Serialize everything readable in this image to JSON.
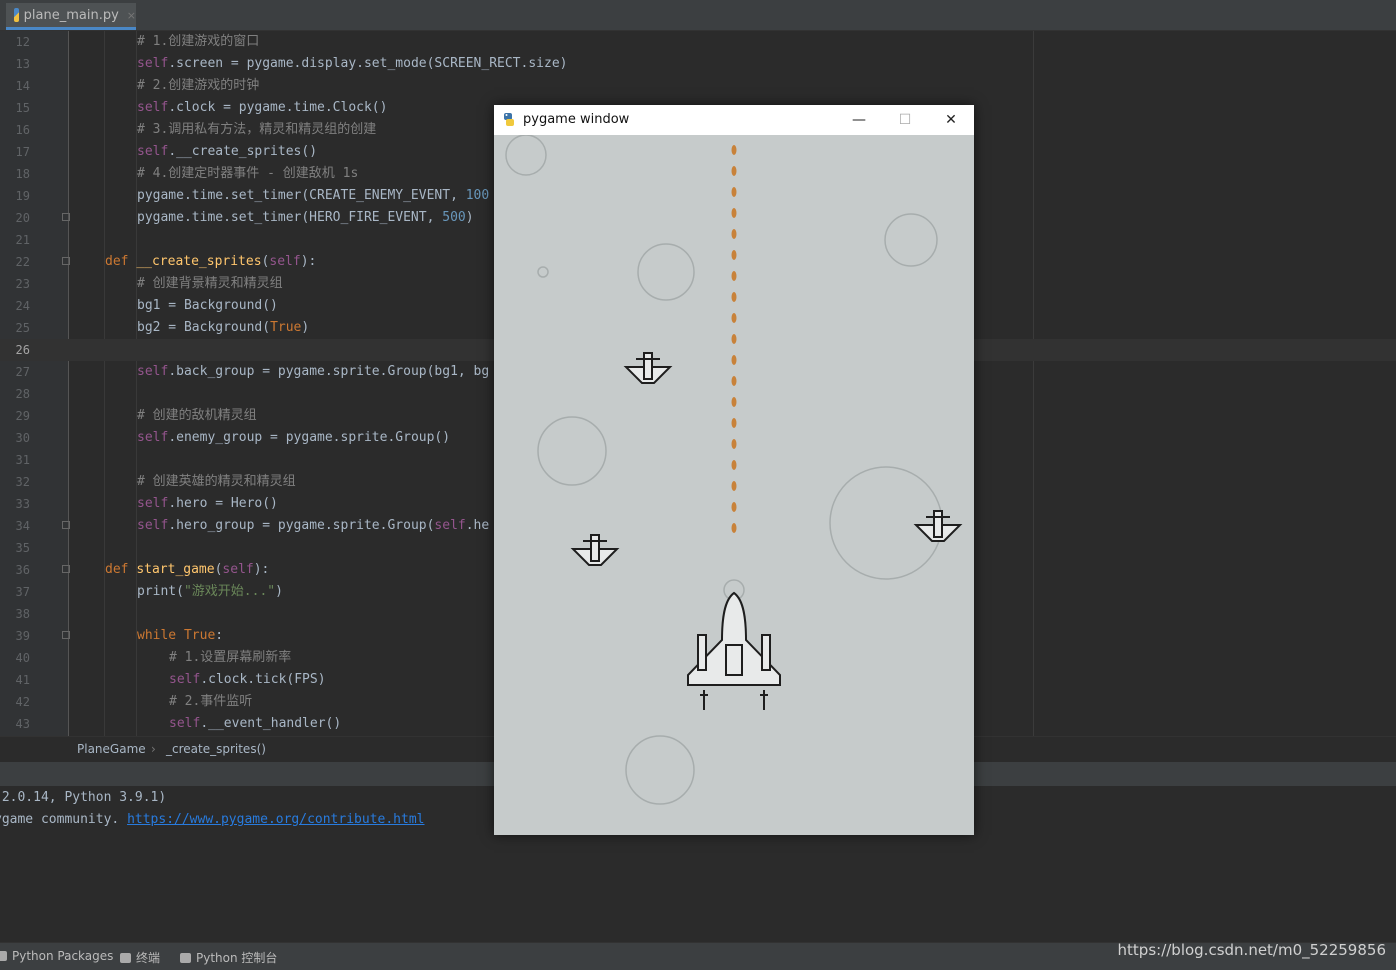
{
  "tab": {
    "filename": "plane_main.py",
    "close": "×"
  },
  "code_lines": [
    {
      "n": "12",
      "html": "<span class=\"cm\"># 1.创建游戏的窗口</span>",
      "indent": 2
    },
    {
      "n": "13",
      "html": "<span class=\"self\">self</span>.screen = pygame.display.set_mode(SCREEN_RECT.size)",
      "indent": 2
    },
    {
      "n": "14",
      "html": "<span class=\"cm\"># 2.创建游戏的时钟</span>",
      "indent": 2
    },
    {
      "n": "15",
      "html": "<span class=\"self\">self</span>.clock = pygame.time.Clock()",
      "indent": 2
    },
    {
      "n": "16",
      "html": "<span class=\"cm\"># 3.调用私有方法，精灵和精灵组的创建</span>",
      "indent": 2
    },
    {
      "n": "17",
      "html": "<span class=\"self\">self</span>.__create_sprites()",
      "indent": 2
    },
    {
      "n": "18",
      "html": "<span class=\"cm\"># 4.创建定时器事件 - 创建敌机 1s</span>",
      "indent": 2
    },
    {
      "n": "19",
      "html": "pygame.time.set_timer(CREATE_ENEMY_EVENT, <span class=\"num\">100</span>",
      "indent": 2
    },
    {
      "n": "20",
      "html": "pygame.time.set_timer(HERO_FIRE_EVENT, <span class=\"num\">500</span>)",
      "indent": 2,
      "fold": true
    },
    {
      "n": "21",
      "html": "",
      "indent": 0
    },
    {
      "n": "22",
      "html": "<span class=\"kw\">def </span><span class=\"fn\">__create_sprites</span>(<span class=\"self\">self</span>):",
      "indent": 1,
      "fold": true
    },
    {
      "n": "23",
      "html": "<span class=\"cm\"># 创建背景精灵和精灵组</span>",
      "indent": 2
    },
    {
      "n": "24",
      "html": "bg1 = Background()",
      "indent": 2
    },
    {
      "n": "25",
      "html": "bg2 = Background(<span class=\"kw\">True</span>)",
      "indent": 2
    },
    {
      "n": "26",
      "html": "",
      "indent": 0,
      "current": true
    },
    {
      "n": "27",
      "html": "<span class=\"self\">self</span>.back_group = pygame.sprite.Group(bg1, bg",
      "indent": 2
    },
    {
      "n": "28",
      "html": "",
      "indent": 0
    },
    {
      "n": "29",
      "html": "<span class=\"cm\"># 创建的敌机精灵组</span>",
      "indent": 2
    },
    {
      "n": "30",
      "html": "<span class=\"self\">self</span>.enemy_group = pygame.sprite.Group()",
      "indent": 2
    },
    {
      "n": "31",
      "html": "",
      "indent": 0
    },
    {
      "n": "32",
      "html": "<span class=\"cm\"># 创建英雄的精灵和精灵组</span>",
      "indent": 2
    },
    {
      "n": "33",
      "html": "<span class=\"self\">self</span>.hero = Hero()",
      "indent": 2
    },
    {
      "n": "34",
      "html": "<span class=\"self\">self</span>.hero_group = pygame.sprite.Group(<span class=\"self\">self</span>.he",
      "indent": 2,
      "fold": true
    },
    {
      "n": "35",
      "html": "",
      "indent": 0
    },
    {
      "n": "36",
      "html": "<span class=\"kw\">def </span><span class=\"fn\">start_game</span>(<span class=\"self\">self</span>):",
      "indent": 1,
      "fold": true
    },
    {
      "n": "37",
      "html": "print(<span class=\"str\">\"游戏开始...\"</span>)",
      "indent": 2
    },
    {
      "n": "38",
      "html": "",
      "indent": 0
    },
    {
      "n": "39",
      "html": "<span class=\"kw\">while True</span>:",
      "indent": 2,
      "fold": true
    },
    {
      "n": "40",
      "html": "<span class=\"cm\"># 1.设置屏幕刷新率</span>",
      "indent": 3
    },
    {
      "n": "41",
      "html": "<span class=\"self\">self</span>.clock.tick(FPS)",
      "indent": 3
    },
    {
      "n": "42",
      "html": "<span class=\"cm\"># 2.事件监听</span>",
      "indent": 3
    },
    {
      "n": "43",
      "html": "<span class=\"self\">self</span>.__event_handler()",
      "indent": 3
    }
  ],
  "breadcrumb": {
    "class_name": "PlaneGame",
    "separator": "›",
    "method": "_create_sprites()"
  },
  "console": {
    "line1": " 2.0.14, Python 3.9.1)",
    "line2_prefix": "ygame community. ",
    "line2_link": "https://www.pygame.org/contribute.html"
  },
  "statusbar": {
    "python_packages": "Python Packages",
    "terminal": "终端",
    "python_console": "Python 控制台",
    "watermark": "https://blog.csdn.net/m0_52259856"
  },
  "pygame_window": {
    "title": "pygame window",
    "minimize": "—",
    "maximize": "☐",
    "close": "✕"
  }
}
